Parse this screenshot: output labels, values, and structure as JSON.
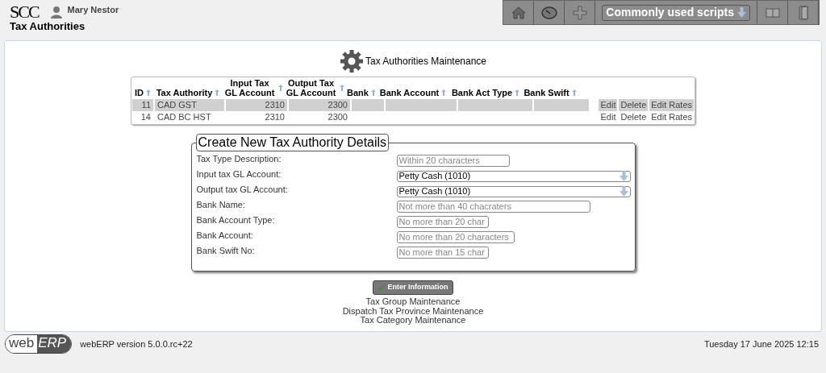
{
  "header": {
    "logo": "SCC",
    "user": "Mary Nestor",
    "page_title": "Tax Authorities",
    "scripts_button": "Commonly used scripts"
  },
  "section_title": "Tax Authorities Maintenance",
  "table": {
    "columns": [
      "ID",
      "Tax Authority",
      "Input Tax GL Account",
      "Output Tax GL Account",
      "Bank",
      "Bank Account",
      "Bank Act Type",
      "Bank Swift"
    ],
    "rows": [
      {
        "selected": true,
        "cells": [
          "11",
          "CAD GST",
          "2310",
          "2300",
          "",
          "",
          "",
          ""
        ],
        "actions": [
          "Edit",
          "Delete",
          "Edit Rates"
        ]
      },
      {
        "selected": false,
        "cells": [
          "14",
          "CAD BC HST",
          "2310",
          "2300",
          "",
          "",
          "",
          ""
        ],
        "actions": [
          "Edit",
          "Delete",
          "Edit Rates"
        ]
      }
    ]
  },
  "form": {
    "legend": "Create New Tax Authority Details",
    "fields": [
      {
        "label": "Tax Type Description:",
        "kind": "text",
        "placeholder": "Within 20 characters"
      },
      {
        "label": "Input tax GL Account:",
        "kind": "select",
        "value": "Petty Cash (1010)"
      },
      {
        "label": "Output tax GL Account:",
        "kind": "select",
        "value": "Petty Cash (1010)"
      },
      {
        "label": "Bank Name:",
        "kind": "text",
        "placeholder": "Not more than 40 chacraters"
      },
      {
        "label": "Bank Account Type:",
        "kind": "text",
        "placeholder": "No more than 20 char"
      },
      {
        "label": "Bank Account:",
        "kind": "text",
        "placeholder": "No more than 20 characters"
      },
      {
        "label": "Bank Swift No:",
        "kind": "text",
        "placeholder": "No more than 15 char"
      }
    ]
  },
  "submit_button": "Enter Information",
  "links": [
    "Tax Group Maintenance",
    "Dispatch Tax Province Maintenance",
    "Tax Category Maintenance"
  ],
  "footer": {
    "logo_left": "web",
    "logo_right": "ERP",
    "version": "webERP version 5.0.0.rc+22",
    "datetime": "Tuesday 17 June 2025 12:15"
  }
}
